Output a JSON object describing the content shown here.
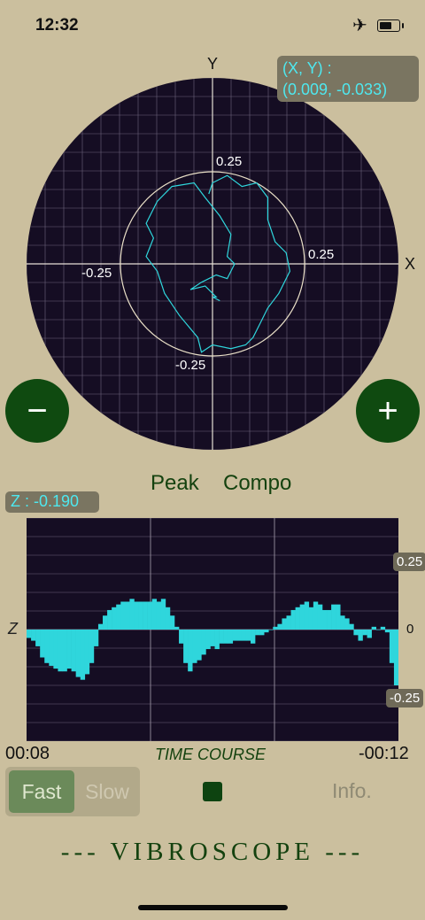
{
  "status_bar": {
    "time": "12:32",
    "airplane_icon": "airplane-icon",
    "battery_icon": "battery-icon"
  },
  "scope": {
    "y_axis_label": "Y",
    "x_axis_label": "X",
    "readout_title": "(X, Y)  :",
    "readout_value": "(0.009, -0.033)",
    "labels": {
      "y_pos": "0.25",
      "x_pos": "0.25",
      "x_neg": "-0.25",
      "y_neg": "-0.25"
    },
    "zoom_out": "−",
    "zoom_in": "+"
  },
  "modes": {
    "peak": "Peak",
    "compo": "Compo"
  },
  "timecourse": {
    "z_readout": "Z : -0.190",
    "z_axis": "Z",
    "tick_pos": "0.25",
    "tick_zero": "0",
    "tick_neg": "-0.25",
    "time_start": "00:08",
    "time_end": "-00:12",
    "title": "TIME COURSE"
  },
  "controls": {
    "fast": "Fast",
    "slow": "Slow",
    "info": "Info."
  },
  "app_title": "--- VIBROSCOPE ---",
  "colors": {
    "background": "#cbbf9e",
    "scope_bg": "#150d23",
    "trace": "#2fd6dc",
    "button_green": "#0f4a10"
  },
  "chart_data": {
    "type": "bar",
    "ylim": [
      -0.4,
      0.4
    ],
    "values": [
      -0.03,
      -0.04,
      -0.06,
      -0.1,
      -0.12,
      -0.13,
      -0.14,
      -0.15,
      -0.15,
      -0.14,
      -0.15,
      -0.17,
      -0.18,
      -0.16,
      -0.12,
      -0.06,
      0.02,
      0.05,
      0.07,
      0.08,
      0.09,
      0.1,
      0.1,
      0.11,
      0.1,
      0.1,
      0.1,
      0.1,
      0.11,
      0.1,
      0.11,
      0.08,
      0.05,
      0.01,
      -0.05,
      -0.12,
      -0.15,
      -0.12,
      -0.11,
      -0.09,
      -0.07,
      -0.06,
      -0.07,
      -0.05,
      -0.05,
      -0.05,
      -0.04,
      -0.04,
      -0.04,
      -0.04,
      -0.05,
      -0.02,
      -0.02,
      -0.01,
      0.0,
      0.01,
      0.02,
      0.04,
      0.05,
      0.07,
      0.08,
      0.09,
      0.1,
      0.08,
      0.1,
      0.09,
      0.07,
      0.07,
      0.09,
      0.09,
      0.05,
      0.04,
      0.02,
      -0.02,
      -0.04,
      -0.02,
      -0.03,
      0.01,
      0.0,
      0.01,
      -0.01,
      -0.12,
      -0.2
    ]
  },
  "scope_trace": [
    [
      -0.01,
      0.19
    ],
    [
      0.0,
      0.22
    ],
    [
      0.04,
      0.24
    ],
    [
      0.08,
      0.21
    ],
    [
      0.12,
      0.22
    ],
    [
      0.15,
      0.18
    ],
    [
      0.15,
      0.12
    ],
    [
      0.17,
      0.06
    ],
    [
      0.2,
      0.03
    ],
    [
      0.21,
      -0.02
    ],
    [
      0.18,
      -0.08
    ],
    [
      0.15,
      -0.12
    ],
    [
      0.13,
      -0.16
    ],
    [
      0.11,
      -0.2
    ],
    [
      0.09,
      -0.22
    ],
    [
      0.05,
      -0.23
    ],
    [
      0.0,
      -0.22
    ],
    [
      -0.03,
      -0.24
    ],
    [
      -0.04,
      -0.2
    ],
    [
      -0.09,
      -0.14
    ],
    [
      -0.13,
      -0.08
    ],
    [
      -0.15,
      -0.02
    ],
    [
      -0.18,
      0.02
    ],
    [
      -0.16,
      0.07
    ],
    [
      -0.18,
      0.11
    ],
    [
      -0.15,
      0.17
    ],
    [
      -0.11,
      0.21
    ],
    [
      -0.05,
      0.22
    ],
    [
      -0.02,
      0.18
    ],
    [
      0.02,
      0.13
    ],
    [
      0.05,
      0.08
    ],
    [
      0.04,
      0.02
    ],
    [
      0.06,
      0.0
    ],
    [
      0.04,
      -0.04
    ],
    [
      0.01,
      -0.03
    ],
    [
      -0.03,
      -0.05
    ],
    [
      -0.06,
      -0.07
    ],
    [
      -0.02,
      -0.06
    ],
    [
      0.01,
      -0.09
    ],
    [
      0.0,
      -0.09
    ],
    [
      0.02,
      -0.1
    ]
  ]
}
